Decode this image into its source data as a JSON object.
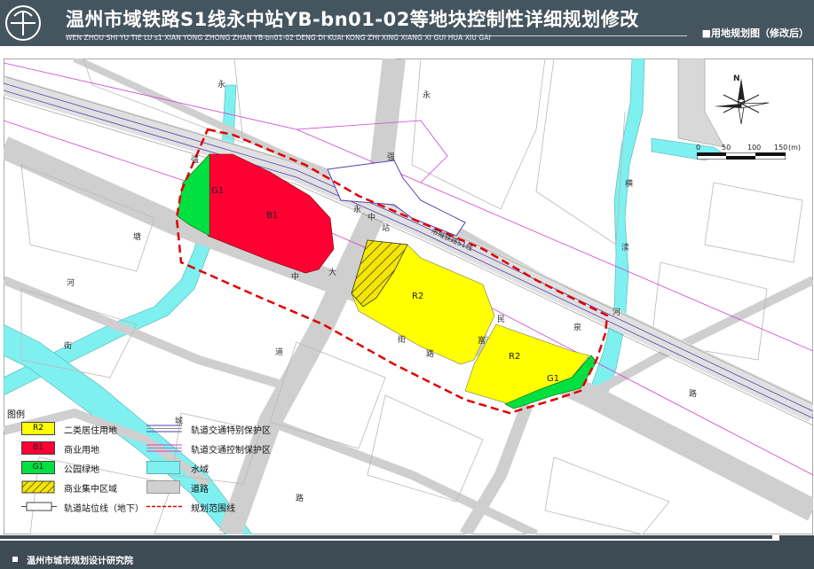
{
  "header": {
    "title": "温州市域铁路S1线永中站YB-bn01-02等地块控制性详细规划修改",
    "subtitle": "WEN ZHOU SHI YU TIE LU s1 XIAN YONG ZHONG ZHAN YB-bn01-02 DENG DI KUAI KONG ZHI XING XIANG XI GUI HUA XIU GAI",
    "drawing_label": "■用地规划图（修改后）"
  },
  "map": {
    "parcels": [
      {
        "code": "B1",
        "label": "B1"
      },
      {
        "code": "G1a",
        "label": "G1"
      },
      {
        "code": "R2a",
        "label": "R2"
      },
      {
        "code": "R2b",
        "label": "R2"
      },
      {
        "code": "G1b",
        "label": "G1"
      }
    ],
    "rail_label": "市域铁路S1线",
    "road_chars": [
      "永",
      "强",
      "塘",
      "河",
      "街",
      "永",
      "强",
      "永",
      "中",
      "站",
      "大",
      "中",
      "道",
      "街",
      "路",
      "民",
      "富",
      "泉",
      "横",
      "渎",
      "河",
      "路",
      "城",
      "路"
    ],
    "compass_letter": "N",
    "scale": {
      "ticks": [
        "0",
        "50",
        "100",
        "150"
      ],
      "unit": "(m)"
    }
  },
  "legend": {
    "title": "图例",
    "items": [
      {
        "swatch": "R2",
        "label": "二类居住用地",
        "color": "#ffff00"
      },
      {
        "swatch": "B1",
        "label": "商业用地",
        "color": "#ff0033"
      },
      {
        "swatch": "G1",
        "label": "公园绿地",
        "color": "#00e040"
      },
      {
        "swatch": "",
        "label": "商业集中区域",
        "color": "#f5d000"
      },
      {
        "swatch": "",
        "label": "轨道站位线（地下）",
        "color": "#ffffff"
      },
      {
        "swatch": "",
        "label": "轨道交通特别保护区",
        "color": "#5540b0"
      },
      {
        "swatch": "",
        "label": "轨道交通控制保护区",
        "color": "#d040d0"
      },
      {
        "swatch": "",
        "label": "水域",
        "color": "#7ff0f0"
      },
      {
        "swatch": "",
        "label": "道路",
        "color": "#d0d0d0"
      },
      {
        "swatch": "",
        "label": "规划范围线",
        "color": "#e00000"
      }
    ]
  },
  "footer": {
    "org": "温州市城市规划设计研究院"
  },
  "colors": {
    "header_bg": "#455560",
    "water": "#7ff0f0",
    "road": "#cfcfcf",
    "commercial": "#ff0033",
    "residential": "#ffff00",
    "green": "#00e040",
    "boundary": "#e00000"
  }
}
